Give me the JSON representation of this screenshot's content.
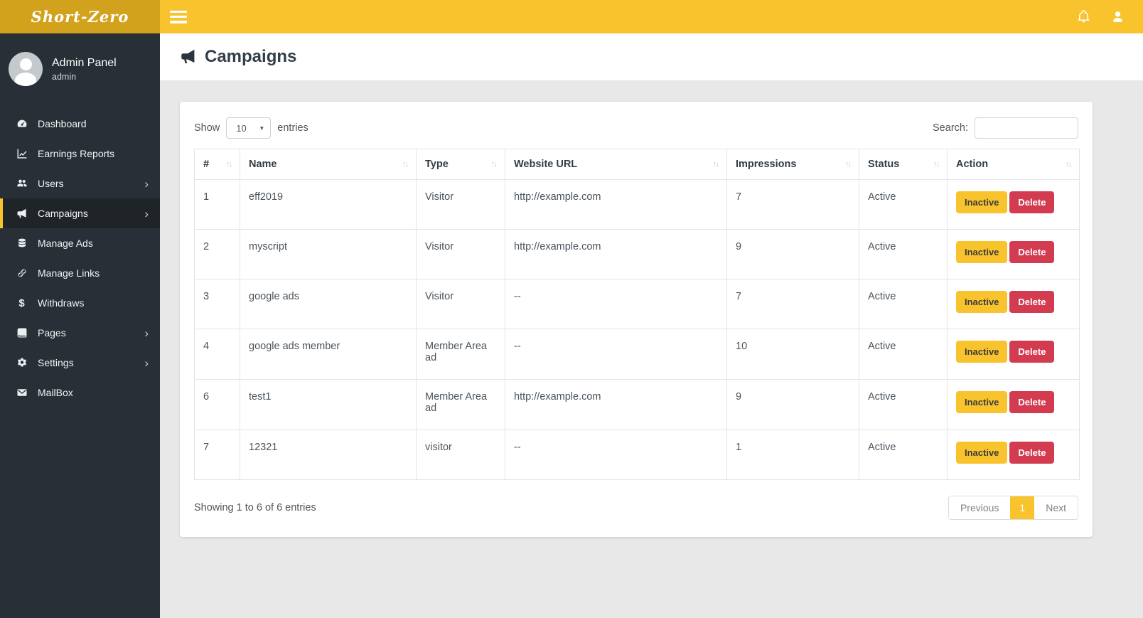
{
  "topbar": {
    "logo": "Short-Zero"
  },
  "icons": {
    "chevron_right": "›",
    "sort": "↑↓",
    "select_arrow": "▼"
  },
  "colors": {
    "accent_yellow": "#f9c32e",
    "logo_gold": "#d2a21c",
    "sidebar_dark": "#282f36",
    "danger_red": "#d33c50",
    "link_orange": "#f2b33d"
  },
  "sidebar": {
    "user": {
      "name": "Admin Panel",
      "role": "admin"
    },
    "items": [
      {
        "label": "Dashboard"
      },
      {
        "label": "Earnings Reports"
      },
      {
        "label": "Users"
      },
      {
        "label": "Campaigns"
      },
      {
        "label": "Manage Ads"
      },
      {
        "label": "Manage Links"
      },
      {
        "label": "Withdraws"
      },
      {
        "label": "Pages"
      },
      {
        "label": "Settings"
      },
      {
        "label": "MailBox"
      }
    ]
  },
  "page": {
    "title": "Campaigns"
  },
  "table": {
    "show_label": "Show",
    "page_size": "10",
    "entries_label": "entries",
    "search_label": "Search:",
    "search_value": "",
    "columns": [
      "#",
      "Name",
      "Type",
      "Website URL",
      "Impressions",
      "Status",
      "Action"
    ],
    "rows": [
      {
        "num": "1",
        "name": "eff2019",
        "type": "Visitor",
        "url": "http://example.com",
        "impressions": "7",
        "status": "Active"
      },
      {
        "num": "2",
        "name": "myscript",
        "type": "Visitor",
        "url": "http://example.com",
        "impressions": "9",
        "status": "Active"
      },
      {
        "num": "3",
        "name": "google ads",
        "type": "Visitor",
        "url": "--",
        "impressions": "7",
        "status": "Active"
      },
      {
        "num": "4",
        "name": "google ads member",
        "type": "Member Area ad",
        "url": "--",
        "impressions": "10",
        "status": "Active"
      },
      {
        "num": "6",
        "name": "test1",
        "type": "Member Area ad",
        "url": "http://example.com",
        "impressions": "9",
        "status": "Active"
      },
      {
        "num": "7",
        "name": "12321",
        "type": "visitor",
        "url": "--",
        "impressions": "1",
        "status": "Active"
      }
    ],
    "actions": {
      "inactive": "Inactive",
      "delete": "Delete"
    },
    "footer_info": "Showing 1 to 6 of 6 entries",
    "pagination": {
      "previous": "Previous",
      "current": "1",
      "next": "Next"
    }
  }
}
